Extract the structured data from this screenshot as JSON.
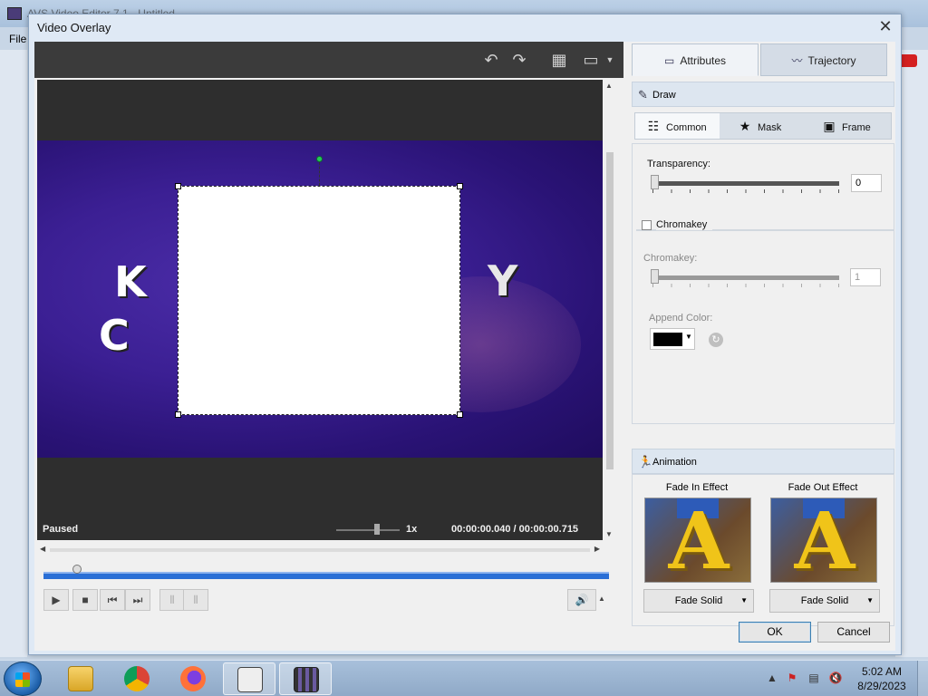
{
  "background_app": {
    "title": "AVS Video Editor 7.1 - Untitled",
    "menu_file": "File"
  },
  "dialog": {
    "title": "Video Overlay",
    "close": "✕"
  },
  "toolbar": {
    "undo_icon": "undo-icon",
    "redo_icon": "redo-icon",
    "grid_icon": "grid-icon",
    "monitor_icon": "monitor-icon"
  },
  "preview": {
    "status": "Paused",
    "speed": "1x",
    "time": "00:00:00.040  /  00:00:00.715",
    "video_letters": [
      "K",
      "C",
      "Y"
    ],
    "timeline_position": 0.04
  },
  "tabs": {
    "attributes": "Attributes",
    "trajectory": "Trajectory"
  },
  "draw": {
    "header": "Draw",
    "subtabs": {
      "common": "Common",
      "mask": "Mask",
      "frame": "Frame"
    },
    "transparency_label": "Transparency:",
    "transparency_value": "0",
    "chromakey_checkbox": "Chromakey",
    "chromakey_label": "Chromakey:",
    "chromakey_value": "1",
    "append_color_label": "Append Color:",
    "append_color": "#000000"
  },
  "animation": {
    "header": "Animation",
    "fade_in_label": "Fade In Effect",
    "fade_out_label": "Fade Out Effect",
    "fade_in_value": "Fade Solid",
    "fade_out_value": "Fade Solid"
  },
  "buttons": {
    "ok": "OK",
    "cancel": "Cancel"
  },
  "taskbar": {
    "time": "5:02 AM",
    "date": "8/29/2023"
  }
}
